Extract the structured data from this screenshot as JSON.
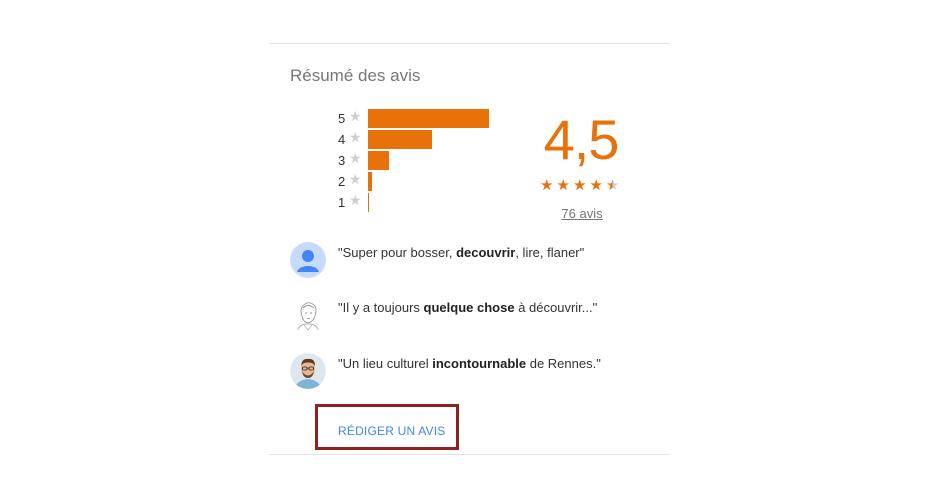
{
  "title": "Résumé des avis",
  "histogram": [
    {
      "stars": "5",
      "count_fraction": 1.0
    },
    {
      "stars": "4",
      "count_fraction": 0.53
    },
    {
      "stars": "3",
      "count_fraction": 0.17
    },
    {
      "stars": "2",
      "count_fraction": 0.035
    },
    {
      "stars": "1",
      "count_fraction": 0.01
    }
  ],
  "rating": {
    "score": "4,5",
    "stars_filled": 4.5,
    "reviews_link": "76 avis"
  },
  "snippets": [
    {
      "pre": "\"Super pour bosser, ",
      "bold": "decouvrir",
      "post": ", lire, flaner\"",
      "avatar_icon": "default-user-avatar"
    },
    {
      "pre": "\"Il y a toujours ",
      "bold": "quelque chose",
      "post": " à découvrir...\"",
      "avatar_icon": "sketch-portrait-avatar"
    },
    {
      "pre": "\"Un lieu culturel ",
      "bold": "incontournable",
      "post": " de Rennes.\"",
      "avatar_icon": "photo-portrait-avatar"
    }
  ],
  "write_review_label": "RÉDIGER UN AVIS",
  "colors": {
    "accent": "#e8710a",
    "star_empty": "#cfcfcf",
    "link_blue": "#4285f4",
    "highlight_border": "#8b2323"
  }
}
